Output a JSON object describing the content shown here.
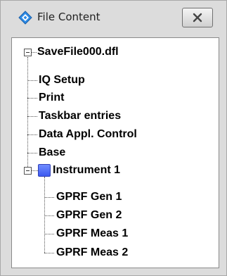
{
  "window": {
    "title": "File Content",
    "app_icon": "rohde-schwarz-diamond-icon",
    "close_icon": "close-x-icon"
  },
  "tree": {
    "root": {
      "label": "SaveFile000.dfl",
      "expanded": true
    },
    "items": [
      {
        "label": "IQ Setup"
      },
      {
        "label": "Print"
      },
      {
        "label": "Taskbar entries"
      },
      {
        "label": "Data Appl. Control"
      },
      {
        "label": "Base"
      },
      {
        "label": "Instrument 1",
        "expanded": true,
        "icon": "instrument-block-icon",
        "icon_color": "#4a66f5",
        "children": [
          {
            "label": "GPRF Gen 1"
          },
          {
            "label": "GPRF Gen 2"
          },
          {
            "label": "GPRF Meas 1"
          },
          {
            "label": "GPRF Meas 2"
          }
        ]
      }
    ]
  }
}
